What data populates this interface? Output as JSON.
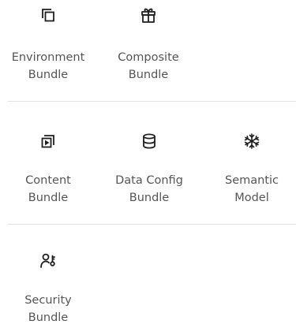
{
  "sections": [
    {
      "tiles": [
        {
          "id": "environment",
          "icon": "copy-icon",
          "line1": "Environment",
          "line2": "Bundle"
        },
        {
          "id": "composite",
          "icon": "gift-icon",
          "line1": "Composite",
          "line2": "Bundle"
        }
      ]
    },
    {
      "tiles": [
        {
          "id": "content",
          "icon": "content-icon",
          "line1": "Content",
          "line2": "Bundle"
        },
        {
          "id": "data-config",
          "icon": "database-icon",
          "line1": "Data Config",
          "line2": "Bundle"
        },
        {
          "id": "semantic",
          "icon": "snowflake-icon",
          "line1": "Semantic",
          "line2": "Model"
        }
      ]
    },
    {
      "tiles": [
        {
          "id": "security",
          "icon": "user-key-icon",
          "line1": "Security",
          "line2": "Bundle"
        }
      ]
    }
  ],
  "colors": {
    "icon": "#1f1f1f",
    "label": "#555555",
    "divider": "#e3e3e3"
  }
}
